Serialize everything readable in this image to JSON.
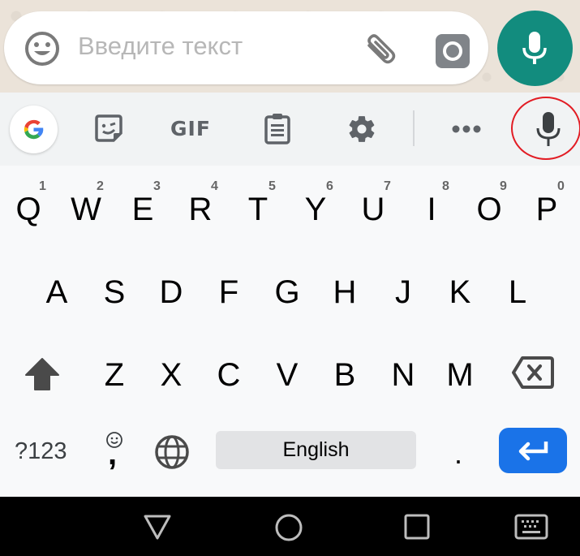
{
  "chat_input": {
    "placeholder": "Введите текст",
    "icons": {
      "emoji": "smiley-face-icon",
      "attach": "paperclip-icon",
      "camera": "camera-icon",
      "voice": "microphone-icon"
    },
    "colors": {
      "fab": "#128c7e",
      "background": "#ebe3d9"
    }
  },
  "toolbar": {
    "items": [
      {
        "name": "google-search",
        "icon": "google-g-icon"
      },
      {
        "name": "stickers",
        "icon": "sticker-icon"
      },
      {
        "name": "gif",
        "label": "GIF"
      },
      {
        "name": "clipboard",
        "icon": "clipboard-icon"
      },
      {
        "name": "settings",
        "icon": "gear-icon"
      },
      {
        "name": "more",
        "icon": "more-horizontal-icon"
      },
      {
        "name": "voice-typing",
        "icon": "microphone-icon",
        "highlighted": true
      }
    ],
    "annotation_color": "#e21c24"
  },
  "keyboard": {
    "row1": [
      {
        "key": "Q",
        "hint": "1"
      },
      {
        "key": "W",
        "hint": "2"
      },
      {
        "key": "E",
        "hint": "3"
      },
      {
        "key": "R",
        "hint": "4"
      },
      {
        "key": "T",
        "hint": "5"
      },
      {
        "key": "Y",
        "hint": "6"
      },
      {
        "key": "U",
        "hint": "7"
      },
      {
        "key": "I",
        "hint": "8"
      },
      {
        "key": "O",
        "hint": "9"
      },
      {
        "key": "P",
        "hint": "0"
      }
    ],
    "row2": [
      "A",
      "S",
      "D",
      "F",
      "G",
      "H",
      "J",
      "K",
      "L"
    ],
    "row3": [
      "Z",
      "X",
      "C",
      "V",
      "B",
      "N",
      "M"
    ],
    "shift_icon": "shift-arrow-icon",
    "backspace_icon": "backspace-icon",
    "symbols_label": "?123",
    "comma_label": ",",
    "comma_hint_icon": "smiley-icon",
    "globe_icon": "globe-icon",
    "space_label": "English",
    "period_label": ".",
    "enter_icon": "enter-arrow-icon",
    "colors": {
      "enter": "#1a73e8",
      "space": "#e2e3e5"
    }
  },
  "nav_bar": {
    "buttons": [
      "back-triangle-icon",
      "home-circle-icon",
      "recents-square-icon",
      "keyboard-switch-icon"
    ]
  }
}
